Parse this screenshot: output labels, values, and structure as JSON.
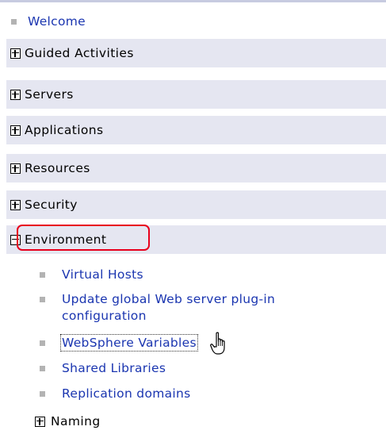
{
  "nav": {
    "welcome": "Welcome",
    "sections": [
      {
        "label": "Guided Activities",
        "state": "collapsed"
      },
      {
        "label": "Servers",
        "state": "collapsed"
      },
      {
        "label": "Applications",
        "state": "collapsed"
      },
      {
        "label": "Resources",
        "state": "collapsed"
      },
      {
        "label": "Security",
        "state": "collapsed"
      },
      {
        "label": "Environment",
        "state": "expanded"
      }
    ],
    "environment_items": [
      {
        "lines": [
          "Virtual Hosts"
        ]
      },
      {
        "lines": [
          "Update global Web server plug-in",
          "configuration"
        ]
      },
      {
        "lines": [
          "WebSphere Variables"
        ]
      },
      {
        "lines": [
          "Shared Libraries"
        ]
      },
      {
        "lines": [
          "Replication domains"
        ]
      }
    ],
    "naming": "Naming"
  },
  "colors": {
    "link": "#1a35b0",
    "bar_background": "#e5e6f1",
    "highlight": "#e8001c",
    "bullet": "#b3b3b3"
  },
  "icons": {
    "collapsed": "plus-box-icon",
    "expanded": "minus-box-icon",
    "bullet": "square-bullet-icon",
    "cursor": "hand-pointer-icon"
  }
}
